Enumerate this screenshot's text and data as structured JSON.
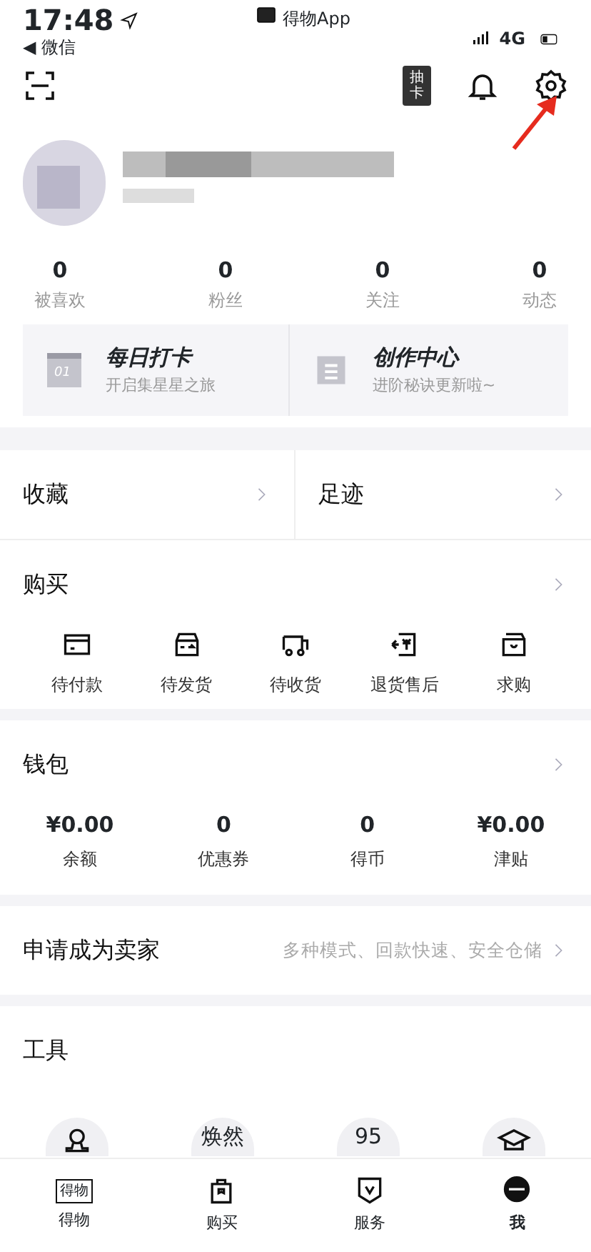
{
  "status_bar": {
    "time": "17:48",
    "app_title": "得物App",
    "back_label": "◀ 微信",
    "network": "4G"
  },
  "header": {
    "draw_card_label": "抽卡"
  },
  "stats": [
    {
      "value": "0",
      "label": "被喜欢"
    },
    {
      "value": "0",
      "label": "粉丝"
    },
    {
      "value": "0",
      "label": "关注"
    },
    {
      "value": "0",
      "label": "动态"
    }
  ],
  "promo_cards": [
    {
      "kind": "calendar",
      "badge": "01",
      "title": "每日打卡",
      "subtitle": "开启集星星之旅"
    },
    {
      "kind": "document",
      "title": "创作中心",
      "subtitle": "进阶秘诀更新啦~"
    }
  ],
  "links": [
    {
      "label": "收藏"
    },
    {
      "label": "足迹"
    }
  ],
  "purchase": {
    "title": "购买",
    "items": [
      {
        "kind": "card",
        "label": "待付款"
      },
      {
        "kind": "box",
        "label": "待发货"
      },
      {
        "kind": "truck",
        "label": "待收货"
      },
      {
        "kind": "refund",
        "label": "退货售后"
      },
      {
        "kind": "bag",
        "label": "求购"
      }
    ]
  },
  "wallet": {
    "title": "钱包",
    "items": [
      {
        "value": "¥0.00",
        "label": "余额"
      },
      {
        "value": "0",
        "label": "优惠券"
      },
      {
        "value": "0",
        "label": "得币"
      },
      {
        "value": "¥0.00",
        "label": "津贴"
      }
    ]
  },
  "seller": {
    "title": "申请成为卖家",
    "hint": "多种模式、回款快速、安全仓储"
  },
  "tools": {
    "title": "工具",
    "items": [
      {
        "kind": "person"
      },
      {
        "kind": "text",
        "text": "焕然"
      },
      {
        "kind": "text",
        "text": "95"
      },
      {
        "kind": "cap"
      }
    ]
  },
  "tab_bar": [
    {
      "kind": "logo",
      "logo": "得物",
      "label": "得物",
      "selected": false
    },
    {
      "kind": "bag",
      "label": "购买",
      "selected": false
    },
    {
      "kind": "shield",
      "label": "服务",
      "selected": false
    },
    {
      "kind": "avatar",
      "label": "我",
      "selected": true
    }
  ]
}
